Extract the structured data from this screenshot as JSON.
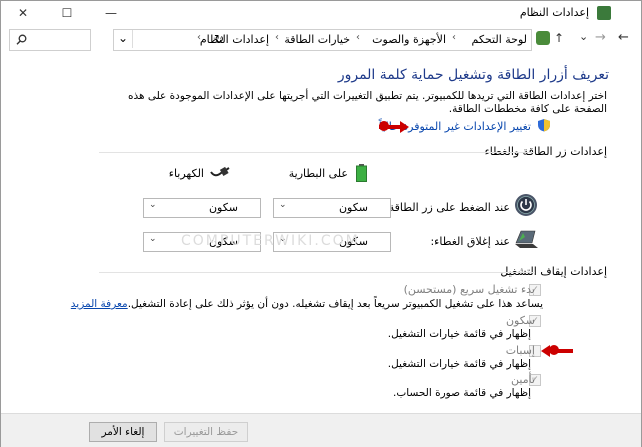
{
  "window": {
    "title": "إعدادات النظام",
    "min_glyph": "—",
    "max_glyph": "☐",
    "close_glyph": "✕"
  },
  "address": {
    "crumbs": [
      "لوحة التحكم",
      "الأجهزة والصوت",
      "خيارات الطاقة",
      "إعدادات النظام"
    ],
    "search_icon": "search-icon",
    "refresh_glyph": "↻",
    "dropdown_glyph": "⌄"
  },
  "nav": {
    "back_glyph": "←",
    "forward_glyph": "→",
    "up_glyph": "↑",
    "recent_glyph": "⌄"
  },
  "page": {
    "heading": "تعريف أزرار الطاقة وتشغيل حماية كلمة المرور",
    "intro": "اختر إعدادات الطاقة التي تريدها للكمبيوتر. يتم تطبيق التغييرات التي أجريتها على الإعدادات الموجودة على هذه الصفحة على كافة مخططات الطاقة.",
    "change_unavailable": "تغيير الإعدادات غير المتوفرة حالياً"
  },
  "power_section": {
    "title": "إعدادات زر الطاقة والغطاء",
    "col_battery": "على البطارية",
    "col_plugged": "الكهرباء",
    "rows": [
      {
        "label": "عند الضغط على زر الطاقة:",
        "battery": "سكون",
        "plugged": "سكون"
      },
      {
        "label": "عند إغلاق الغطاء:",
        "battery": "سكون",
        "plugged": "سكون"
      }
    ]
  },
  "shutdown_section": {
    "title": "إعدادات إيقاف التشغيل",
    "items": [
      {
        "label": "بدء تشغيل سريع (مستحسن)",
        "desc": "يساعد هذا على تشغيل الكمبيوتر سريعاً بعد إيقاف تشغيله. دون أن يؤثر ذلك على إعادة التشغيل.",
        "link": "معرفة المزيد",
        "checked": true
      },
      {
        "label": "سكون",
        "desc": "إظهار في قائمة خيارات التشغيل.",
        "checked": true
      },
      {
        "label": "إسبات",
        "desc": "إظهار في قائمة خيارات التشغيل.",
        "checked": false
      },
      {
        "label": "تأمين",
        "desc": "إظهار في قائمة صورة الحساب.",
        "checked": true
      }
    ]
  },
  "buttons": {
    "save": "حفظ التغييرات",
    "cancel": "إلغاء الأمر"
  },
  "watermark": "COMPUTERWIKI.COM",
  "colors": {
    "heading": "#1e3a8a",
    "link": "#0645ad",
    "annotation_arrow": "#cc0000"
  }
}
